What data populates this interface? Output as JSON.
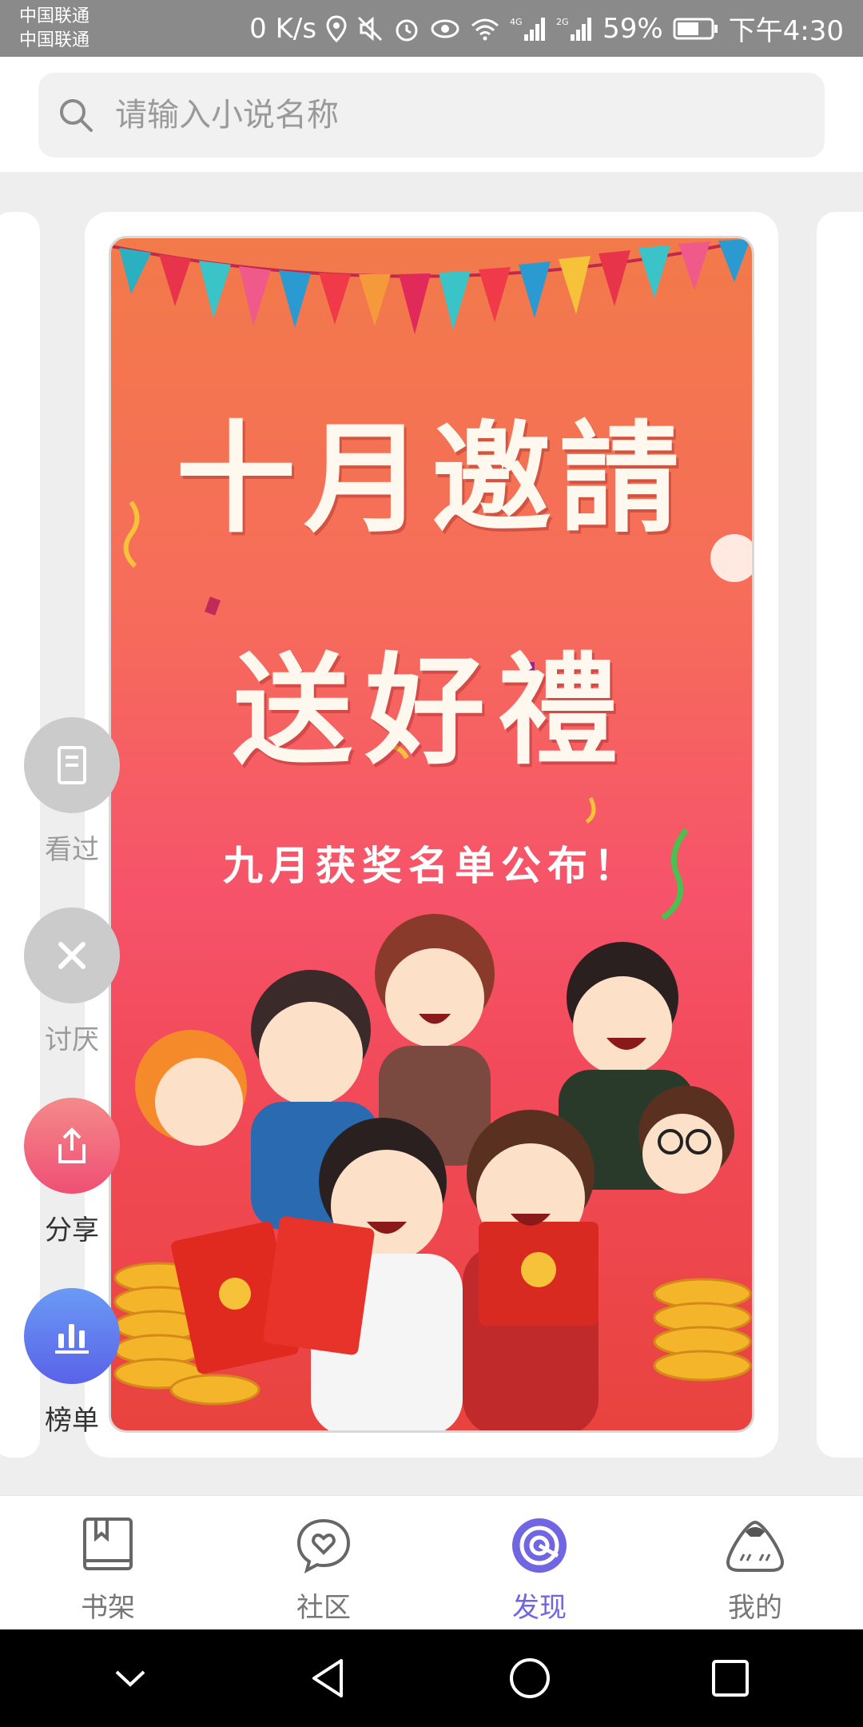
{
  "status_bar": {
    "carrier_1": "中国联通",
    "carrier_2": "中国联通",
    "net_speed": "0 K/s",
    "battery": "59%",
    "time": "下午4:30",
    "icons": [
      "location-icon",
      "mute-icon",
      "alarm-icon",
      "eye-icon",
      "wifi-icon",
      "signal-4g-icon",
      "signal-2g-icon",
      "battery-icon"
    ]
  },
  "search": {
    "placeholder": "请输入小说名称"
  },
  "banner": {
    "title_line1": "十月邀請",
    "title_line2": "送好禮",
    "subtitle": "九月获奖名单公布！"
  },
  "actions": [
    {
      "label": "看过",
      "icon": "bookmark-page-icon",
      "color": "#c8c8c8"
    },
    {
      "label": "讨厌",
      "icon": "close-icon",
      "color": "#c8c8c8"
    },
    {
      "label": "分享",
      "icon": "share-icon",
      "color": "#f0627a"
    },
    {
      "label": "榜单",
      "icon": "bar-chart-icon",
      "color": "#5a7cf0"
    }
  ],
  "bottom_nav": {
    "items": [
      {
        "label": "书架",
        "icon": "bookshelf-icon"
      },
      {
        "label": "社区",
        "icon": "community-heart-icon"
      },
      {
        "label": "发现",
        "icon": "discover-icon",
        "active": true
      },
      {
        "label": "我的",
        "icon": "profile-onigiri-icon"
      }
    ],
    "active_color": "#7065e2"
  },
  "system_nav": [
    "collapse-icon",
    "back-icon",
    "home-icon",
    "recents-icon"
  ]
}
